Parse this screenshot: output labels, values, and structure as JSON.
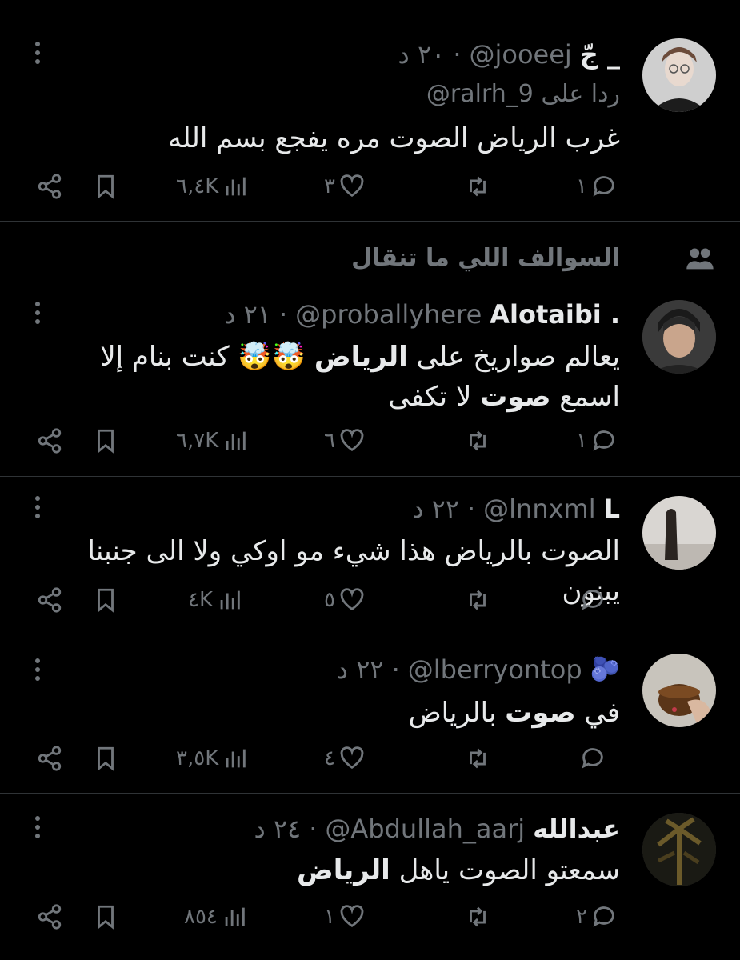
{
  "tweets": [
    {
      "name": "جّ _",
      "handle": "@jooeej",
      "dot": "·",
      "time": "٢٠ د",
      "reply_prefix": "ردا على",
      "reply_handle": "@ralrh_9",
      "text": "غرب الرياض الصوت مره يفجع بسم الله",
      "replies": "١",
      "likes": "٣",
      "views": "٦,٤K",
      "icons": [
        "reply-icon",
        "retweet-icon",
        "like-icon",
        "views-icon",
        "bookmark-icon",
        "share-icon"
      ]
    },
    {
      "social_context": "السوالف اللي ما تنقال",
      "name": "Alotaibi .",
      "handle": "@proballyhere",
      "dot": "·",
      "time": "٢١ د",
      "text_part1": "يعالم صواريخ على ",
      "text_bold1": "الرياض",
      "text_emoji": " 🤯🤯 ",
      "text_part2": "كنت بنام إلا اسمع ",
      "text_bold2": "صوت",
      "text_part3": " لا تكفى",
      "replies": "١",
      "likes": "٦",
      "views": "٦,٧K"
    },
    {
      "name": "L",
      "handle": "@lnnxml",
      "dot": "·",
      "time": "٢٢ د",
      "text": "الصوت بالرياض هذا شيء مو اوكي ولا الى جنبنا يبنون",
      "replies": "",
      "likes": "٥",
      "views": "٤K"
    },
    {
      "name": "🫐",
      "handle": "@lberryontop",
      "dot": "·",
      "time": "٢٢ د",
      "text_plain": "في ",
      "text_bold": "صوت",
      "text_rest": " بالرياض",
      "replies": "",
      "likes": "٤",
      "views": "٣,٥K"
    },
    {
      "name": "عبدالله",
      "handle": "@Abdullah_aarj",
      "dot": "·",
      "time": "٢٤ د",
      "text_plain": "سمعتو الصوت ياهل ",
      "text_bold": "الرياض",
      "replies": "٢",
      "likes": "١",
      "views": "٨٥٤"
    }
  ],
  "colors": {
    "background": "#000000",
    "text": "#e7e9ea",
    "muted": "#71767b",
    "divider": "#2f3336"
  }
}
